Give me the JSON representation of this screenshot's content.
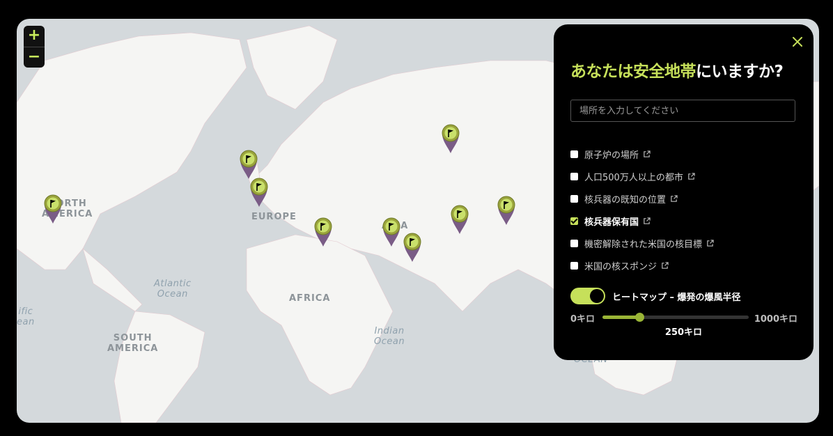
{
  "map": {
    "continents": [
      "NORTH\nAMERICA",
      "EUROPE",
      "ASIA",
      "AFRICA",
      "SOUTH\nAMERICA"
    ],
    "oceans": [
      "Atlantic\nOcean",
      "Indian\nOcean",
      "ific\nean",
      "OCEAN"
    ],
    "zoom_in_label": "+",
    "zoom_out_label": "−",
    "marker_icon": "flag-icon",
    "marker_colors": {
      "head": "#9aa43c",
      "body": "#7a5c86"
    }
  },
  "panel": {
    "title_highlight": "あなたは安全地帯",
    "title_rest": "にいますか?",
    "search_placeholder": "場所を入力してください",
    "options": [
      {
        "label": "原子炉の場所",
        "checked": false
      },
      {
        "label": "人口500万人以上の都市",
        "checked": false
      },
      {
        "label": "核兵器の既知の位置",
        "checked": false
      },
      {
        "label": "核兵器保有国",
        "checked": true
      },
      {
        "label": "機密解除された米国の核目標",
        "checked": false
      },
      {
        "label": "米国の核スポンジ",
        "checked": false
      }
    ],
    "heatmap_label": "ヒートマップ – 爆発の爆風半径",
    "heatmap_on": true,
    "range_min": "0キロ",
    "range_max": "1000キロ",
    "range_value_label": "250キロ",
    "range_fraction": 0.25,
    "accent_color": "#c6e05a"
  }
}
